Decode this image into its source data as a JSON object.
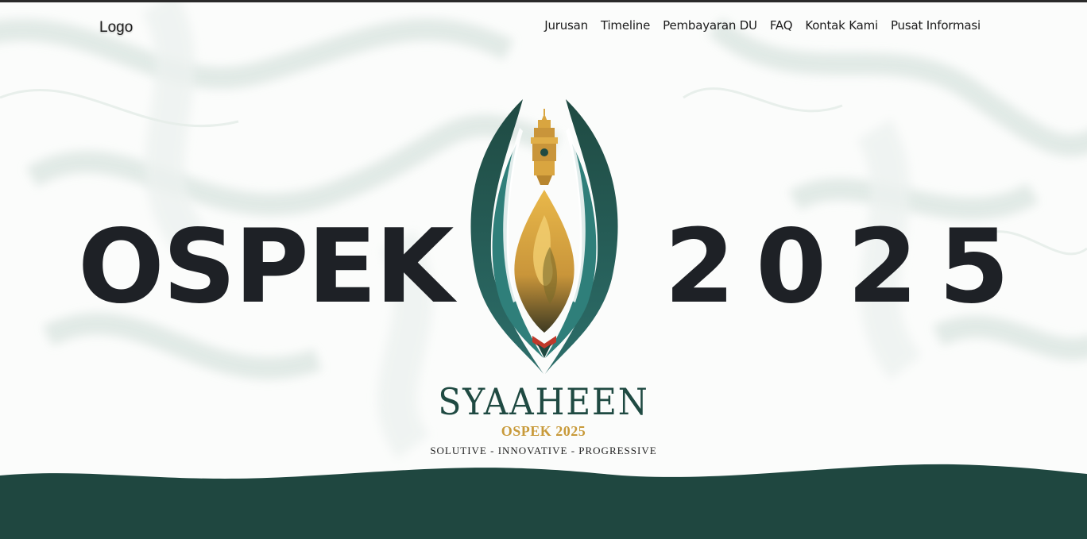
{
  "navbar": {
    "logo": "Logo",
    "links": [
      "Jurusan",
      "Timeline",
      "Pembayaran DU",
      "FAQ",
      "Kontak Kami",
      "Pusat Informasi"
    ]
  },
  "hero": {
    "left_word": "OSPEK",
    "right_word": "2025"
  },
  "brand": {
    "name": "SYAAHEEN",
    "subtitle": "OSPEK 2025",
    "tagline": "SOLUTIVE - INNOVATIVE - PROGRESSIVE"
  },
  "colors": {
    "dark_green": "#1f4740",
    "teal": "#2e7b78",
    "gold": "#c89a3a",
    "text_dark": "#1e2126",
    "red_accent": "#c0392b"
  },
  "icons": {
    "emblem": "flame-tower-emblem-icon"
  }
}
